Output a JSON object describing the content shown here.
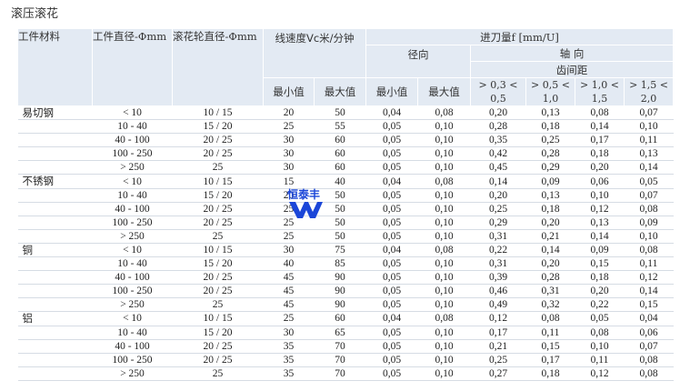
{
  "title": "滚压滚花",
  "header": {
    "material": "工件材料",
    "diameter": "工件直径-Φmm",
    "wheel_diameter": "滚花轮直径-Φmm",
    "speed": "线速度Vc米/分钟",
    "feed": "进刀量f [mm/U]",
    "radial": "径向",
    "axial": "轴 向",
    "pitch": "齿间距",
    "min": "最小值",
    "max": "最大值",
    "pitch_ranges": [
      {
        "top": "> 0,3 <",
        "bottom": "0,5"
      },
      {
        "top": "> 0,5 <",
        "bottom": "1,0"
      },
      {
        "top": "> 1,0 <",
        "bottom": "1,5"
      },
      {
        "top": "> 1,5 <",
        "bottom": "2,0"
      }
    ]
  },
  "groups": [
    {
      "material": "易切钢",
      "rows": [
        [
          "< 10",
          "10 / 15",
          "20",
          "50",
          "0,04",
          "0,08",
          "0,20",
          "0,13",
          "0,08",
          "0,07"
        ],
        [
          "10 - 40",
          "15 / 20",
          "25",
          "55",
          "0,05",
          "0,10",
          "0,28",
          "0,18",
          "0,14",
          "0,10"
        ],
        [
          "40 - 100",
          "20 / 25",
          "30",
          "60",
          "0,05",
          "0,10",
          "0,35",
          "0,25",
          "0,17",
          "0,11"
        ],
        [
          "100 - 250",
          "20 / 25",
          "30",
          "60",
          "0,05",
          "0,10",
          "0,42",
          "0,28",
          "0,18",
          "0,13"
        ],
        [
          "> 250",
          "25",
          "30",
          "60",
          "0,05",
          "0,10",
          "0,45",
          "0,29",
          "0,20",
          "0,14"
        ]
      ]
    },
    {
      "material": "不锈钢",
      "rows": [
        [
          "< 10",
          "10 / 15",
          "15",
          "40",
          "0,04",
          "0,08",
          "0,14",
          "0,09",
          "0,06",
          "0,05"
        ],
        [
          "10 - 40",
          "15 / 20",
          "20",
          "50",
          "0,05",
          "0,10",
          "0,20",
          "0,13",
          "0,10",
          "0,07"
        ],
        [
          "40 - 100",
          "20 / 25",
          "25",
          "50",
          "0,05",
          "0,10",
          "0,25",
          "0,18",
          "0,12",
          "0,08"
        ],
        [
          "100 - 250",
          "20 / 25",
          "25",
          "50",
          "0,05",
          "0,10",
          "0,29",
          "0,20",
          "0,13",
          "0,09"
        ],
        [
          "> 250",
          "25",
          "25",
          "50",
          "0,05",
          "0,10",
          "0,31",
          "0,21",
          "0,14",
          "0,10"
        ]
      ]
    },
    {
      "material": "铜",
      "rows": [
        [
          "< 10",
          "10 / 15",
          "30",
          "75",
          "0,04",
          "0,08",
          "0,22",
          "0,14",
          "0,09",
          "0,08"
        ],
        [
          "10 - 40",
          "15 / 20",
          "40",
          "85",
          "0,05",
          "0,10",
          "0,31",
          "0,20",
          "0,15",
          "0,11"
        ],
        [
          "40 - 100",
          "20 / 25",
          "45",
          "90",
          "0,05",
          "0,10",
          "0,39",
          "0,28",
          "0,18",
          "0,12"
        ],
        [
          "100 - 250",
          "20 / 25",
          "45",
          "90",
          "0,05",
          "0,10",
          "0,46",
          "0,31",
          "0,20",
          "0,14"
        ],
        [
          "> 250",
          "25",
          "45",
          "90",
          "0,05",
          "0,10",
          "0,49",
          "0,32",
          "0,22",
          "0,15"
        ]
      ]
    },
    {
      "material": "铝",
      "rows": [
        [
          "< 10",
          "10 / 15",
          "25",
          "60",
          "0,04",
          "0,08",
          "0,12",
          "0,08",
          "0,05",
          "0,04"
        ],
        [
          "10 - 40",
          "15 / 20",
          "30",
          "65",
          "0,05",
          "0,10",
          "0,17",
          "0,11",
          "0,08",
          "0,06"
        ],
        [
          "40 - 100",
          "20 / 25",
          "35",
          "70",
          "0,05",
          "0,10",
          "0,21",
          "0,15",
          "0,10",
          "0,07"
        ],
        [
          "100 - 250",
          "20 / 25",
          "35",
          "70",
          "0,05",
          "0,10",
          "0,25",
          "0,17",
          "0,11",
          "0,08"
        ],
        [
          "> 250",
          "25",
          "35",
          "70",
          "0,05",
          "0,10",
          "0,27",
          "0,18",
          "0,12",
          "0,08"
        ]
      ]
    }
  ],
  "watermark": {
    "text": "恒泰丰",
    "color": "#1b46d8"
  }
}
